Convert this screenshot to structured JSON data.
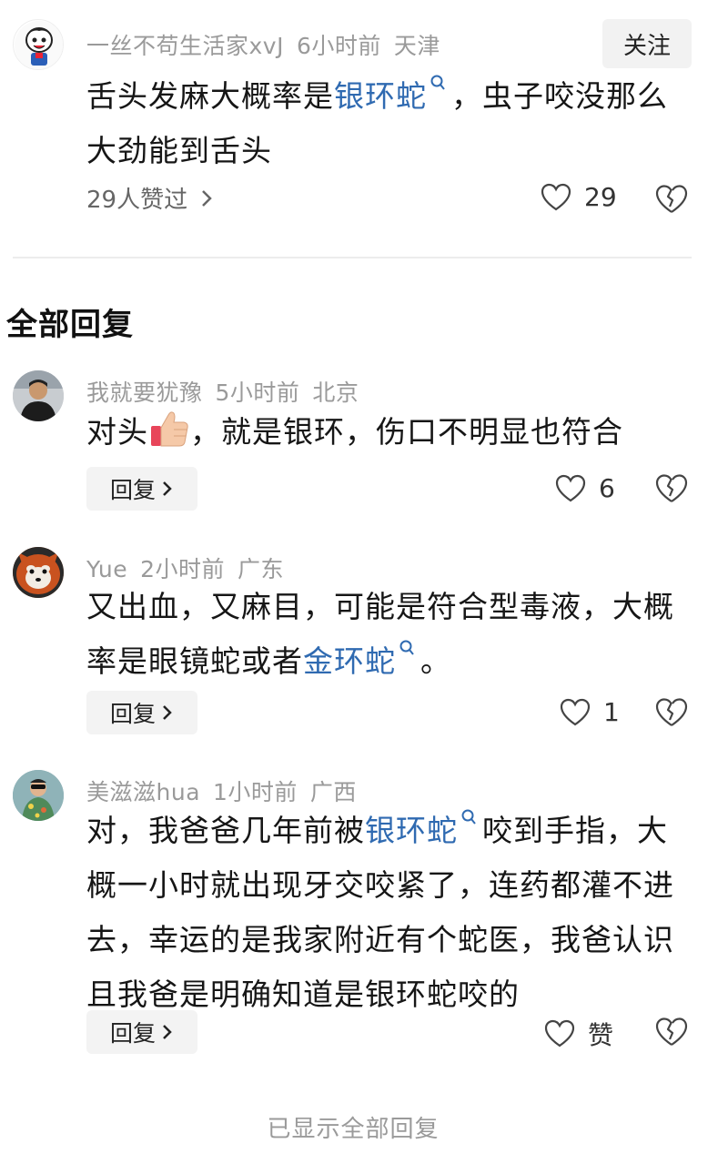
{
  "top_comment": {
    "username": "一丝不苟生活家xvJ",
    "time": "6小时前",
    "location": "天津",
    "follow_label": "关注",
    "text_before": "舌头发麻大概率是",
    "link": "银环蛇",
    "text_after": "，虫子咬没那么大劲能到舌头",
    "liked_by": "29人赞过",
    "like_count": "29"
  },
  "section_title": "全部回复",
  "replies": [
    {
      "username": "我就要犹豫",
      "time": "5小时前",
      "location": "北京",
      "text_before": "对头",
      "emoji": "thumbs-up",
      "text_after": "，就是银环，伤口不明显也符合",
      "reply_label": "回复",
      "like_count": "6"
    },
    {
      "username": "Yue",
      "time": "2小时前",
      "location": "广东",
      "text_before": "又出血，又麻目，可能是符合型毒液，大概率是眼镜蛇或者",
      "link": "金环蛇",
      "text_after": "。",
      "reply_label": "回复",
      "like_count": "1"
    },
    {
      "username": "美滋滋hua",
      "time": "1小时前",
      "location": "广西",
      "text_before": "对，我爸爸几年前被",
      "link": "银环蛇",
      "text_after": "咬到手指，大概一小时就出现牙交咬紧了，连药都灌不进去，幸运的是我家附近有个蛇医，我爸认识且我爸是明确知道是银环蛇咬的",
      "reply_label": "回复",
      "like_label": "赞"
    }
  ],
  "footer": "已显示全部回复",
  "colors": {
    "link": "#2f6ab1",
    "meta": "#9a9a9a",
    "button_bg": "#f3f3f3"
  }
}
